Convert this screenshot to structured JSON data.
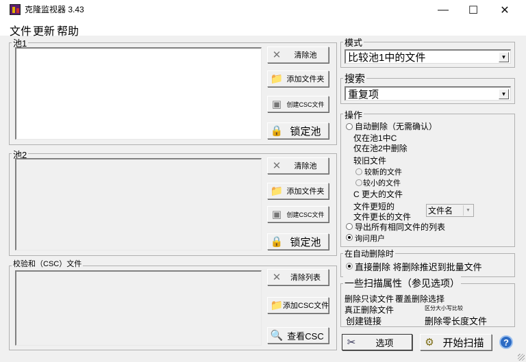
{
  "window": {
    "title": "克隆监视器 3.43",
    "minimize": "—",
    "maximize": "☐",
    "close": "✕"
  },
  "menu": {
    "file": "文件",
    "update": "更新",
    "help": "帮助"
  },
  "pool1": {
    "label": "池1",
    "clear": "清除池",
    "add_folder": "添加文件夹",
    "create_csc": "创建CSC文件",
    "lock": "锁定池"
  },
  "pool2": {
    "label": "池2",
    "clear": "清除池",
    "add_folder": "添加文件夹",
    "create_csc": "创建CSC文件",
    "lock": "锁定池"
  },
  "checksum": {
    "label": "校验和（CSC）文件",
    "clear": "清除列表",
    "add_csc": "添加CSC文件",
    "view_csc": "查看CSC"
  },
  "mode": {
    "label": "模式",
    "value": "比较池1中的文件"
  },
  "search": {
    "label": "搜索",
    "value": "重复项"
  },
  "operation": {
    "label": "操作",
    "auto_delete": "自动删除（无需确认）",
    "only_in_pool1": "仅在池1中C",
    "only_delete_in_pool2": "仅在池2中删除",
    "older_files": "较旧文件",
    "newer_files": "较新的文件",
    "smaller_files": "较小的文件",
    "larger_files": "C 更大的文件",
    "shorter_name": "文件更短的",
    "longer_name": "文件更长的文件",
    "name_select": "文件名",
    "export_list": "导出所有相同文件的列表",
    "ask_user": "询问用户"
  },
  "auto_delete_group": {
    "label": "在自动删除时",
    "direct_delete": "直接删除 将删除推迟到批量文件"
  },
  "scan_props": {
    "label": "一些扫描属性（参见选项）",
    "delete_readonly": "删除只读文件",
    "overwrite_delete": "覆盖删除选择",
    "true_delete": "真正删除文件",
    "case_sensitive": "区分大小写比较",
    "create_links": "创建链接",
    "delete_zero_length": "删除零长度文件"
  },
  "footer": {
    "options": "选项",
    "start_scan": "开始扫描",
    "help_glyph": "?"
  },
  "icons": {
    "clear": "✕",
    "lock": "🔒",
    "folder": "📁",
    "csc": "▣",
    "view": "🔍",
    "tools": "✂",
    "gear": "⚙"
  }
}
